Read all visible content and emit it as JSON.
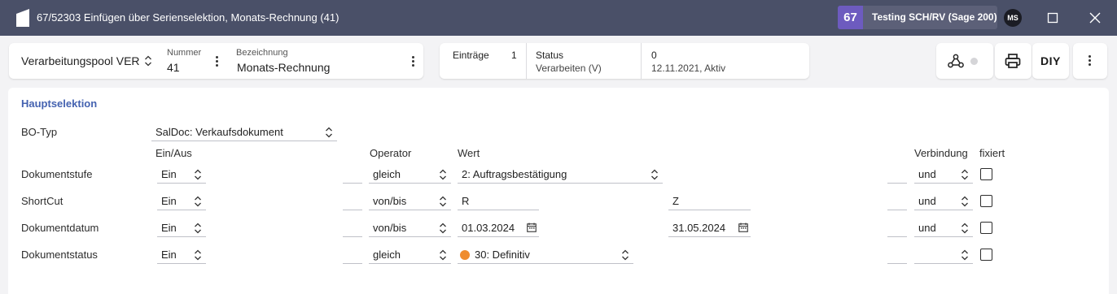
{
  "window": {
    "title": "67/52303 Einfügen über Serienselektion, Monats-Rechnung (41)",
    "tenant_number": "67",
    "tenant_name": "Testing SCH/RV (Sage 200)",
    "user_initials": "MS"
  },
  "header": {
    "pool": "Verarbeitungspool VER",
    "nummer_label": "Nummer",
    "nummer_value": "41",
    "bezeichnung_label": "Bezeichnung",
    "bezeichnung_value": "Monats-Rechnung",
    "eintraege_label": "Einträge",
    "eintraege_value": "1",
    "status_label": "Status",
    "status_value": "Verarbeiten (V)",
    "info_count": "0",
    "info_date": "12.11.2021, Aktiv"
  },
  "toolbar": {
    "icons": [
      "network-icon",
      "print-icon",
      "diy-icon",
      "more-icon"
    ],
    "diy_label": "DIY"
  },
  "selection": {
    "title": "Hauptselektion",
    "bo_typ_label": "BO-Typ",
    "bo_typ_value": "SalDoc: Verkaufsdokument",
    "columns": {
      "ein_aus": "Ein/Aus",
      "operator": "Operator",
      "wert": "Wert",
      "verbindung": "Verbindung",
      "fixiert": "fixiert"
    },
    "rows": [
      {
        "label": "Dokumentstufe",
        "ein_aus": "Ein",
        "operator": "gleich",
        "wert": "2: Auftragsbestätigung",
        "wert2": "",
        "verbindung": "und",
        "fixiert": false
      },
      {
        "label": "ShortCut",
        "ein_aus": "Ein",
        "operator": "von/bis",
        "wert": "R",
        "wert2": "Z",
        "verbindung": "und",
        "fixiert": false
      },
      {
        "label": "Dokumentdatum",
        "ein_aus": "Ein",
        "operator": "von/bis",
        "wert": "01.03.2024",
        "wert2": "31.05.2024",
        "verbindung": "und",
        "fixiert": false
      },
      {
        "label": "Dokumentstatus",
        "ein_aus": "Ein",
        "operator": "gleich",
        "wert": "30: Definitiv",
        "wert2": "",
        "verbindung": "",
        "fixiert": false,
        "status_color": "#ef8c2e"
      }
    ]
  }
}
